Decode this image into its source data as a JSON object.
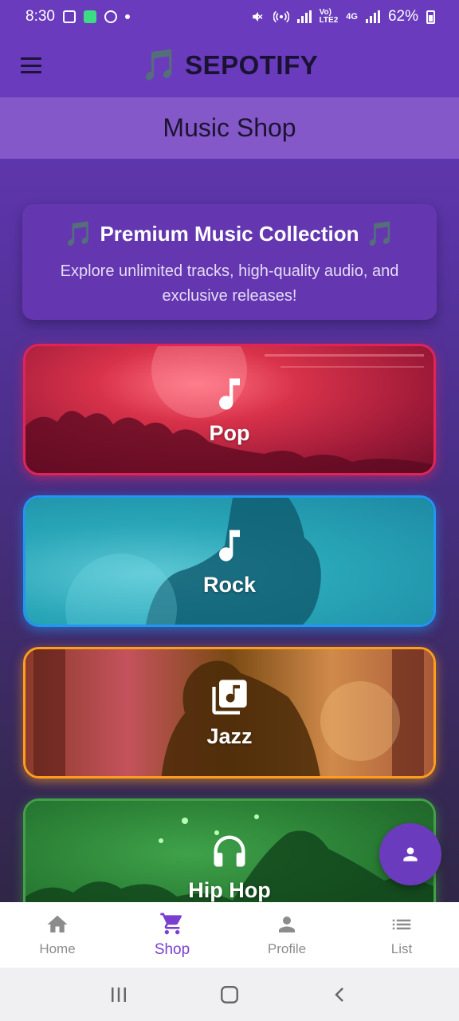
{
  "status_bar": {
    "time": "8:30",
    "battery": "62%",
    "network": "4G"
  },
  "app_bar": {
    "brand_emoji": "🎵",
    "brand_name": "SEPOTIFY"
  },
  "page_title": "Music Shop",
  "premium": {
    "emoji": "🎵",
    "title": "Premium Music Collection",
    "description": "Explore unlimited tracks, high-quality audio, and exclusive releases!"
  },
  "genres": [
    {
      "label": "Pop",
      "icon": "music-note-icon",
      "border_color": "#e0245a"
    },
    {
      "label": "Rock",
      "icon": "music-note-icon",
      "border_color": "#2196f3"
    },
    {
      "label": "Jazz",
      "icon": "library-music-icon",
      "border_color": "#ff9e1b"
    },
    {
      "label": "Hip Hop",
      "icon": "headphones-icon",
      "border_color": "#43a047"
    }
  ],
  "fab": {
    "icon": "person-icon"
  },
  "bottom_nav": {
    "active": "Shop",
    "items": [
      {
        "label": "Home",
        "icon": "home-icon"
      },
      {
        "label": "Shop",
        "icon": "cart-icon"
      },
      {
        "label": "Profile",
        "icon": "person-icon"
      },
      {
        "label": "List",
        "icon": "list-icon"
      }
    ]
  },
  "colors": {
    "accent": "#6a3bbd",
    "active_tab": "#7a3fd0"
  }
}
